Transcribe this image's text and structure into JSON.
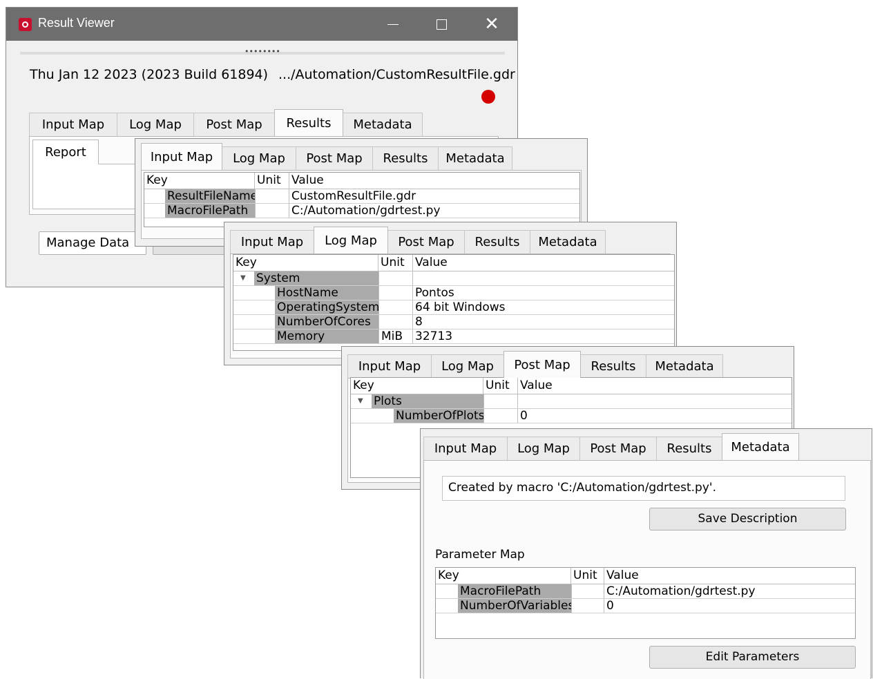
{
  "window": {
    "title": "Result Viewer",
    "minimize": "—",
    "maximize": "☐",
    "close": "✕",
    "splitter_dots": "••••••••",
    "date_build": "Thu Jan 12 2023 (2023 Build 61894)",
    "file_path": ".../Automation/CustomResultFile.gdr",
    "status_color": "#d40000",
    "tabs": [
      "Input Map",
      "Log Map",
      "Post Map",
      "Results",
      "Metadata"
    ],
    "active_tab": "Results",
    "subtab": "Report",
    "manage_data": "Manage Data",
    "manage_chevron": "▾"
  },
  "tab_labels": [
    "Input Map",
    "Log Map",
    "Post Map",
    "Results",
    "Metadata"
  ],
  "columns": {
    "key": "Key",
    "unit": "Unit",
    "value": "Value"
  },
  "input_map": {
    "active_tab": "Input Map",
    "rows": [
      {
        "key": "ResultFileName",
        "unit": "",
        "value": "CustomResultFile.gdr"
      },
      {
        "key": "MacroFilePath",
        "unit": "",
        "value": "C:/Automation/gdrtest.py"
      }
    ]
  },
  "log_map": {
    "active_tab": "Log Map",
    "group": "System",
    "group_icon": "▼",
    "rows": [
      {
        "key": "HostName",
        "unit": "",
        "value": "Pontos"
      },
      {
        "key": "OperatingSystem",
        "unit": "",
        "value": "64 bit Windows"
      },
      {
        "key": "NumberOfCores",
        "unit": "",
        "value": "8"
      },
      {
        "key": "Memory",
        "unit": "MiB",
        "value": "32713"
      }
    ]
  },
  "post_map": {
    "active_tab": "Post Map",
    "group": "Plots",
    "group_icon": "▼",
    "rows": [
      {
        "key": "NumberOfPlots",
        "unit": "",
        "value": "0"
      }
    ]
  },
  "metadata": {
    "active_tab": "Metadata",
    "description": "Created by macro 'C:/Automation/gdrtest.py'.",
    "save_button": "Save Description",
    "parameter_map_label": "Parameter Map",
    "rows": [
      {
        "key": "MacroFilePath",
        "unit": "",
        "value": "C:/Automation/gdrtest.py"
      },
      {
        "key": "NumberOfVariables",
        "unit": "",
        "value": "0"
      }
    ],
    "edit_button": "Edit Parameters"
  }
}
